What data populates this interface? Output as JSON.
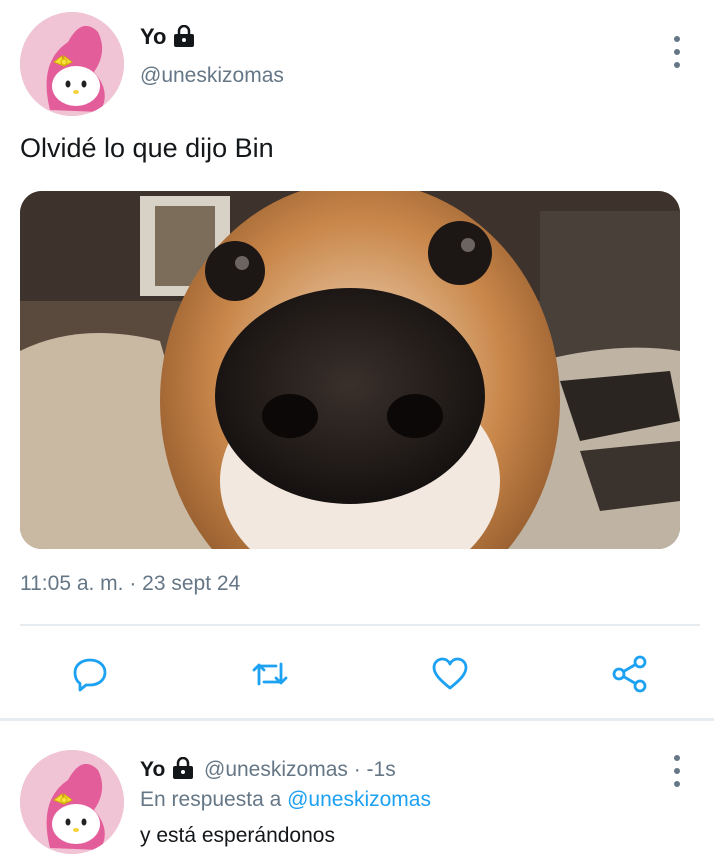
{
  "tweet": {
    "author_name": "Yo",
    "handle": "@uneskizomas",
    "text": "Olvidé lo que dijo Bin",
    "timestamp": "11:05 a. m. · 23 sept 24",
    "lock_icon": "lock-icon",
    "more_icon": "more-vertical-icon",
    "media_subject": "dog-nose-photo"
  },
  "actions": [
    {
      "icon": "reply-icon"
    },
    {
      "icon": "retweet-icon"
    },
    {
      "icon": "like-icon"
    },
    {
      "icon": "share-icon"
    }
  ],
  "reply": {
    "author_name": "Yo",
    "handle": "@uneskizomas",
    "time": "· -1s",
    "replying_prefix": "En respuesta a",
    "replying_handle": "@uneskizomas",
    "text": "y está esperándonos"
  },
  "colors": {
    "secondary_text": "#657786",
    "link": "#1da1f2",
    "divider": "#e6ecf0",
    "icon": "#1da1f2"
  }
}
